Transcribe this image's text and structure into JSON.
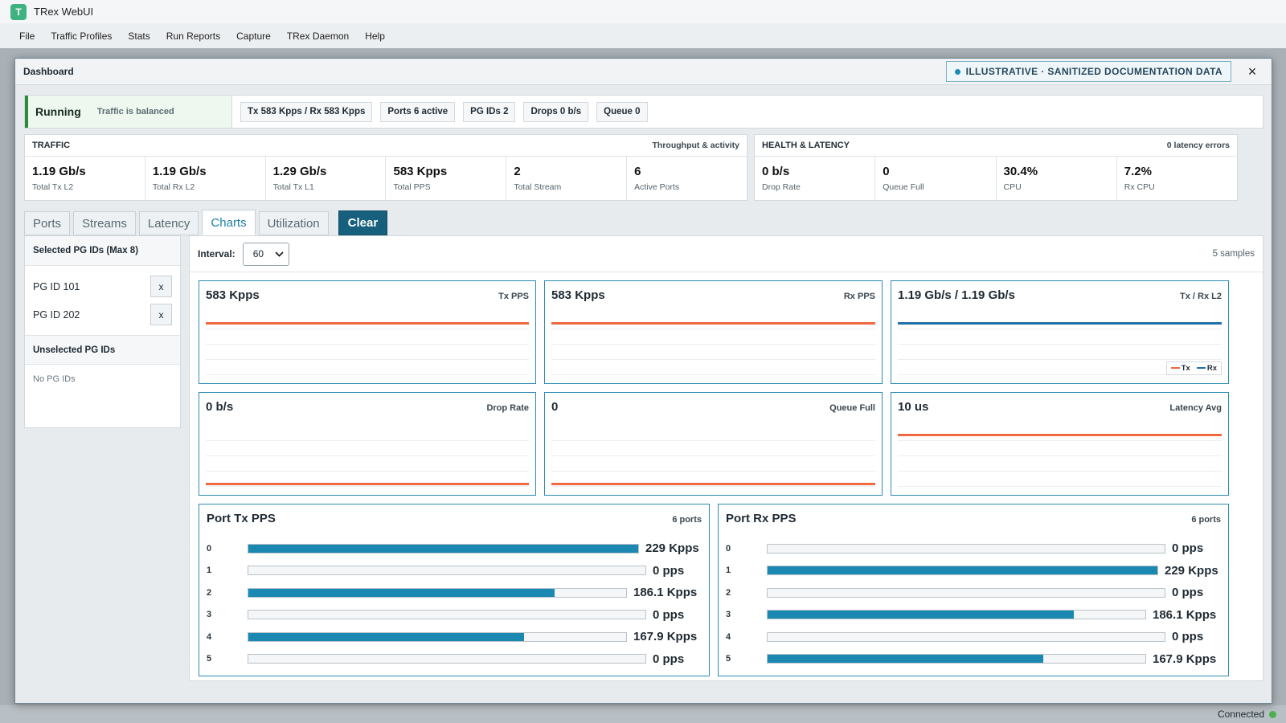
{
  "app": {
    "title": "TRex WebUI",
    "logo_letter": "T"
  },
  "menu": [
    "File",
    "Traffic Profiles",
    "Stats",
    "Run Reports",
    "Capture",
    "TRex Daemon",
    "Help"
  ],
  "status": {
    "text": "Connected",
    "color": "#4caf50"
  },
  "dialog": {
    "title": "Dashboard",
    "badge": "ILLUSTRATIVE · SANITIZED DOCUMENTATION DATA",
    "close": "×",
    "state": "Running",
    "state_note": "Traffic is balanced",
    "pills": [
      "Tx 583 Kpps / Rx 583 Kpps",
      "Ports 6 active",
      "PG IDs 2",
      "Drops 0 b/s",
      "Queue 0"
    ],
    "traffic": {
      "title": "TRAFFIC",
      "sub": "Throughput & activity",
      "metrics": [
        {
          "value": "1.19 Gb/s",
          "label": "Total Tx L2"
        },
        {
          "value": "1.19 Gb/s",
          "label": "Total Rx L2"
        },
        {
          "value": "1.29 Gb/s",
          "label": "Total Tx L1"
        },
        {
          "value": "583 Kpps",
          "label": "Total PPS"
        },
        {
          "value": "2",
          "label": "Total Stream"
        },
        {
          "value": "6",
          "label": "Active Ports"
        }
      ]
    },
    "health": {
      "title": "HEALTH & LATENCY",
      "sub": "0 latency errors",
      "metrics": [
        {
          "value": "0 b/s",
          "label": "Drop Rate"
        },
        {
          "value": "0",
          "label": "Queue Full"
        },
        {
          "value": "30.4%",
          "label": "CPU"
        },
        {
          "value": "7.2%",
          "label": "Rx CPU"
        }
      ]
    },
    "tabs": [
      {
        "label": "Ports",
        "active": false
      },
      {
        "label": "Streams",
        "active": false
      },
      {
        "label": "Latency",
        "active": false
      },
      {
        "label": "Charts",
        "active": true
      },
      {
        "label": "Utilization",
        "active": false
      }
    ],
    "clear_label": "Clear",
    "selected": {
      "title": "Selected PG IDs (Max 8)",
      "items": [
        {
          "label": "PG ID 101",
          "remove": "x"
        },
        {
          "label": "PG ID 202",
          "remove": "x"
        }
      ]
    },
    "unselected": {
      "title": "Unselected PG IDs",
      "empty": "No PG IDs"
    },
    "charts": {
      "interval_label": "Interval:",
      "interval_value": "60",
      "samples": "5 samples",
      "mini": [
        {
          "value": "583 Kpps",
          "label": "Tx PPS",
          "line_level": 1.0,
          "color": "#f0683f"
        },
        {
          "value": "583 Kpps",
          "label": "Rx PPS",
          "line_level": 1.0,
          "color": "#f0683f"
        },
        {
          "value": "1.19 Gb/s / 1.19 Gb/s",
          "label": "Tx / Rx L2",
          "line_level": 1.0,
          "color": "#1f6fa8",
          "legend": [
            {
              "name": "Tx",
              "color": "#f0683f"
            },
            {
              "name": "Rx",
              "color": "#1f6fa8"
            }
          ]
        },
        {
          "value": "0 b/s",
          "label": "Drop Rate",
          "line_level": 0.0,
          "color": "#f0683f"
        },
        {
          "value": "0",
          "label": "Queue Full",
          "line_level": 0.0,
          "color": "#f0683f"
        },
        {
          "value": "10 us",
          "label": "Latency Avg",
          "line_level": 1.0,
          "color": "#f0683f"
        }
      ],
      "port_tx": {
        "title": "Port Tx PPS",
        "sub": "6 ports",
        "rows": [
          {
            "port": "0",
            "value": "229 Kpps",
            "fraction": 1.0
          },
          {
            "port": "1",
            "value": "0 pps",
            "fraction": 0.0
          },
          {
            "port": "2",
            "value": "186.1 Kpps",
            "fraction": 0.81
          },
          {
            "port": "3",
            "value": "0 pps",
            "fraction": 0.0
          },
          {
            "port": "4",
            "value": "167.9 Kpps",
            "fraction": 0.73
          },
          {
            "port": "5",
            "value": "0 pps",
            "fraction": 0.0
          }
        ]
      },
      "port_rx": {
        "title": "Port Rx PPS",
        "sub": "6 ports",
        "rows": [
          {
            "port": "0",
            "value": "0 pps",
            "fraction": 0.0
          },
          {
            "port": "1",
            "value": "229 Kpps",
            "fraction": 1.0
          },
          {
            "port": "2",
            "value": "0 pps",
            "fraction": 0.0
          },
          {
            "port": "3",
            "value": "186.1 Kpps",
            "fraction": 0.81
          },
          {
            "port": "4",
            "value": "0 pps",
            "fraction": 0.0
          },
          {
            "port": "5",
            "value": "167.9 Kpps",
            "fraction": 0.73
          }
        ]
      }
    }
  }
}
